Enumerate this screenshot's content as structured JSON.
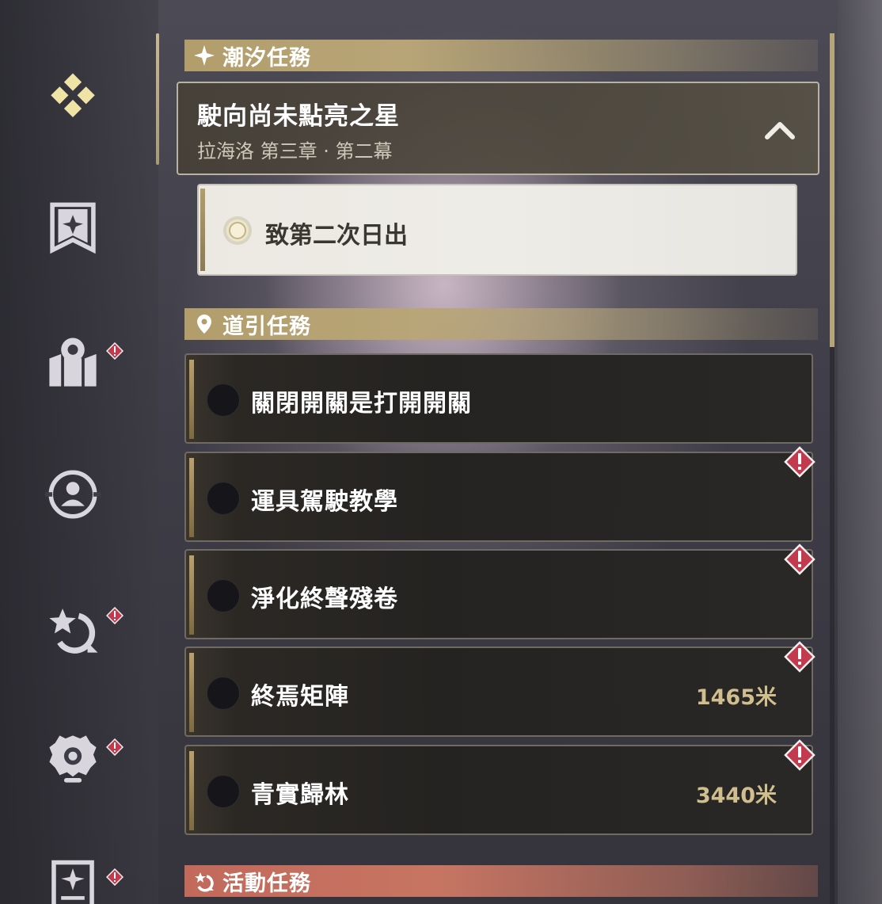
{
  "nav": {
    "items": [
      {
        "name": "quest-home",
        "icon": "diamond-cluster-icon",
        "active": true,
        "badge": false
      },
      {
        "name": "achievement",
        "icon": "banner-star-icon",
        "active": false,
        "badge": false
      },
      {
        "name": "map",
        "icon": "map-pin-icon",
        "active": false,
        "badge": true
      },
      {
        "name": "profile",
        "icon": "person-ring-icon",
        "active": false,
        "badge": false
      },
      {
        "name": "event",
        "icon": "star-refresh-icon",
        "active": false,
        "badge": true
      },
      {
        "name": "settings",
        "icon": "gear-icon",
        "active": false,
        "badge": true
      },
      {
        "name": "notes",
        "icon": "star-document-icon",
        "active": false,
        "badge": true
      }
    ]
  },
  "tidal": {
    "header": "潮汐任務",
    "header_icon": "sparkle-icon",
    "mission": {
      "title": "駛向尚未點亮之星",
      "subtitle": "拉海洛 第三章 · 第二幕",
      "expanded": true
    },
    "objective": {
      "label": "致第二次日出",
      "active": true
    }
  },
  "guide": {
    "header": "道引任務",
    "header_icon": "location-pin-icon",
    "quests": [
      {
        "label": "關閉開關是打開開關",
        "distance": "",
        "alert": false
      },
      {
        "label": "運具駕駛教學",
        "distance": "",
        "alert": true
      },
      {
        "label": "淨化終聲殘卷",
        "distance": "",
        "alert": true
      },
      {
        "label": "終焉矩陣",
        "distance": "1465米",
        "alert": true
      },
      {
        "label": "青實歸林",
        "distance": "3440米",
        "alert": true
      }
    ]
  },
  "event": {
    "header": "活動任務",
    "header_icon": "refresh-star-icon"
  },
  "colors": {
    "gold": "#b29d6b",
    "event_red": "#c2695b",
    "alert": "#c23a4e",
    "distance": "#d1be8e"
  }
}
